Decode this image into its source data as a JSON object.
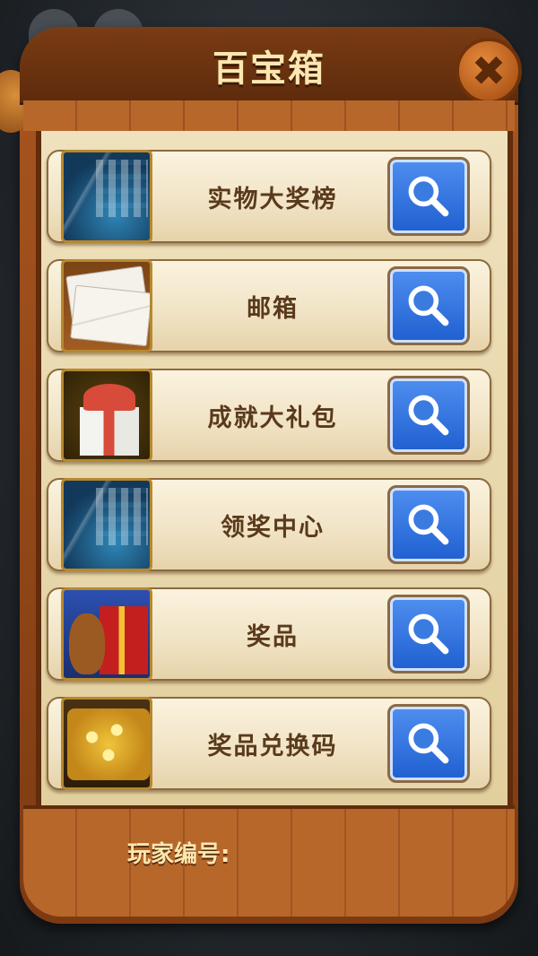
{
  "title": "百宝箱",
  "close_icon": "close-x-icon",
  "items": [
    {
      "label": "实物大奖榜",
      "thumb": "tablet"
    },
    {
      "label": "邮箱",
      "thumb": "mail"
    },
    {
      "label": "成就大礼包",
      "thumb": "gift"
    },
    {
      "label": "领奖中心",
      "thumb": "tablet"
    },
    {
      "label": "奖品",
      "thumb": "bear"
    },
    {
      "label": "奖品兑换码",
      "thumb": "gold"
    }
  ],
  "footer": {
    "player_id_label": "玩家编号:"
  },
  "colors": {
    "wood": "#a9561f",
    "parchment": "#efe1bd",
    "button_blue": "#3a7be0",
    "title_text": "#fbe7b0",
    "label_text": "#5a3a1c"
  }
}
